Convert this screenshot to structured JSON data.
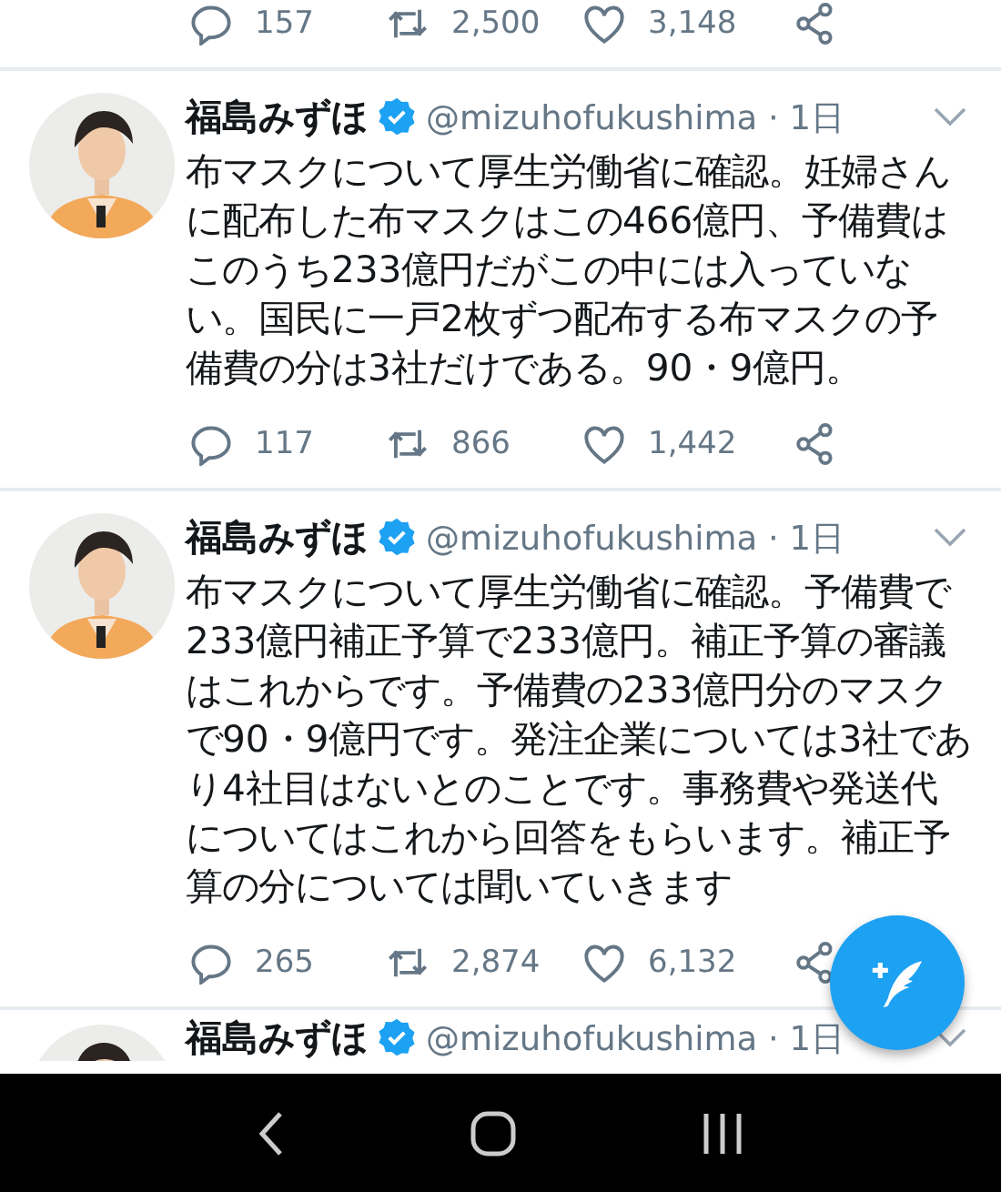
{
  "top_actions": {
    "replies": "157",
    "retweets": "2,500",
    "likes": "3,148"
  },
  "tweets": [
    {
      "name": "福島みずほ",
      "verified": true,
      "meta": "@mizuhofukushima · 1日",
      "text": "布マスクについて厚生労働省に確認。妊婦さんに配布した布マスクはこの466億円、予備費はこのうち233億円だがこの中には入っていない。国民に一戸2枚ずつ配布する布マスクの予備費の分は3社だけである。90・9億円。",
      "actions": {
        "replies": "117",
        "retweets": "866",
        "likes": "1,442"
      }
    },
    {
      "name": "福島みずほ",
      "verified": true,
      "meta": "@mizuhofukushima · 1日",
      "text": "布マスクについて厚生労働省に確認。予備費で233億円補正予算で233億円。補正予算の審議はこれからです。予備費の233億円分のマスクで90・9億円です。発注企業については3社であり4社目はないとのことです。事務費や発送代についてはこれから回答をもらいます。補正予算の分については聞いていきます",
      "actions": {
        "replies": "265",
        "retweets": "2,874",
        "likes": "6,132"
      }
    },
    {
      "name": "福島みずほ",
      "verified": true,
      "meta": "@mizuhofukushima · 1日"
    }
  ]
}
